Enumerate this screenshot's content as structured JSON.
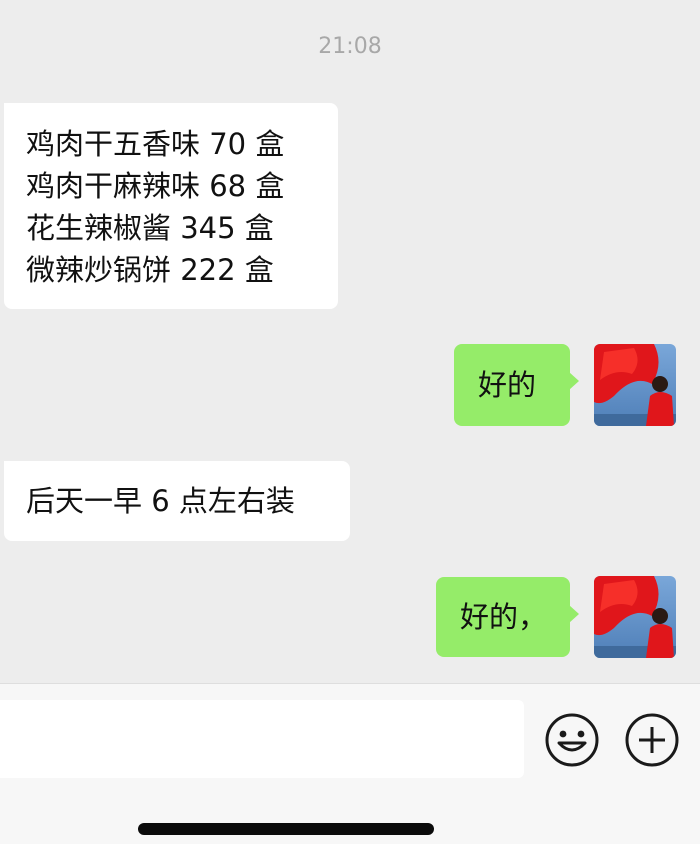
{
  "chat": {
    "timestamp": "21:08",
    "messages": [
      {
        "side": "left",
        "lines": [
          "鸡肉干五香味 70 盒",
          "鸡肉干麻辣味 68 盒",
          "花生辣椒酱 345 盒",
          "微辣炒锅饼 222 盒"
        ]
      },
      {
        "side": "right",
        "text": "好的"
      },
      {
        "side": "left",
        "text": "后天一早 6 点左右装"
      },
      {
        "side": "right",
        "text": "好的，"
      }
    ]
  },
  "colors": {
    "background": "#ededed",
    "incoming_bubble": "#ffffff",
    "outgoing_bubble": "#95ec69",
    "timestamp": "#a8a8a8"
  },
  "input_bar": {
    "text_value": "",
    "emoji_icon": "emoji-smile-icon",
    "add_icon": "plus-circle-icon"
  }
}
